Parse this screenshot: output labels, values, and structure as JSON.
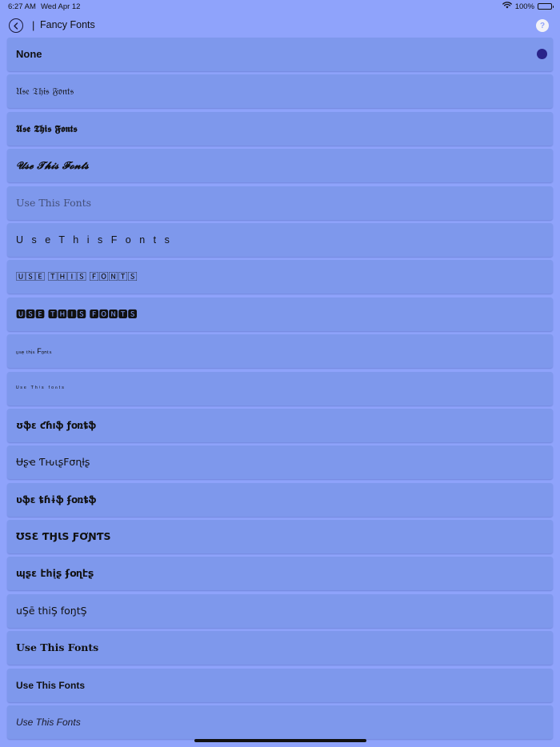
{
  "status_bar": {
    "time": "6:27 AM",
    "date": "Wed Apr 12",
    "battery": "100%"
  },
  "header": {
    "separator": "|",
    "title": "Fancy Fonts",
    "help_glyph": "?"
  },
  "font_options": [
    {
      "label": "None",
      "selected": true
    },
    {
      "label": "𝔘𝔰𝔢 𝔗𝔥𝔦𝔰 𝔉𝔬𝔫𝔱𝔰"
    },
    {
      "label": "𝖀𝖘𝖊 𝕿𝖍𝖎𝖘 𝕱𝖔𝖓𝖙𝖘"
    },
    {
      "label": "𝓤𝓼𝓮 𝓣𝓱𝓲𝓼 𝓕𝓸𝓷𝓽𝓼"
    },
    {
      "label": "Use This Fonts"
    },
    {
      "label": "U s e  T h i s  F o n t s"
    },
    {
      "label": "🅄🅂🄴 🅃🄷🄸🅂 🄵🄾🄽🅃🅂"
    },
    {
      "label": "🆄🆂🅴 🆃🅷🅸🆂 🅵🅾🅽🆃🆂"
    },
    {
      "label": "ᵤₛₑ ₜₕᵢₛ Fₒₙₜₛ"
    },
    {
      "label": "ᵁˢᵉ ᵀʰⁱˢ ᶠᵒⁿᵗˢ"
    },
    {
      "label": "ʊֆɛ ƈɦıֆ ƒօռȶֆ"
    },
    {
      "label": "Ʉʂҽ ƬԋιʂFσɳƚʂ"
    },
    {
      "label": "ʋֆɛ ȶɦɨֆ ʄօռȶֆ"
    },
    {
      "label": "ƱЅƐ ƬӇƖЅ ƑƠƝƬЅ"
    },
    {
      "label": "պʂε էհįʂ ʄօղէʂ"
    },
    {
      "label": "uŞē thiŞ foŋtŞ"
    },
    {
      "label": "Use This Fonts"
    },
    {
      "label": "Use This Fonts"
    },
    {
      "label": "Use This Fonts"
    }
  ],
  "colors": {
    "background": "#8fa3fb",
    "row": "#7e98ec",
    "selected_indicator": "#2a248a"
  },
  "icons": {
    "back": "chevron-left-circle-icon",
    "help": "question-circle-icon",
    "wifi": "wifi-icon",
    "battery": "battery-icon"
  }
}
